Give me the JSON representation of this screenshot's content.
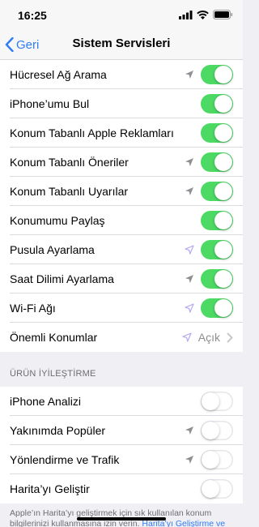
{
  "status": {
    "time": "16:25"
  },
  "nav": {
    "back_label": "Geri",
    "title": "Sistem Servisleri"
  },
  "services": [
    {
      "label": "Hücresel Ağ Arama",
      "arrow": "gray",
      "on": true
    },
    {
      "label": "iPhone’umu Bul",
      "arrow": "none",
      "on": true
    },
    {
      "label": "Konum Tabanlı Apple Reklamları",
      "arrow": "none",
      "on": true
    },
    {
      "label": "Konum Tabanlı Öneriler",
      "arrow": "gray",
      "on": true
    },
    {
      "label": "Konum Tabanlı Uyarılar",
      "arrow": "gray",
      "on": true
    },
    {
      "label": "Konumumu Paylaş",
      "arrow": "none",
      "on": true
    },
    {
      "label": "Pusula Ayarlama",
      "arrow": "purple-outline",
      "on": true
    },
    {
      "label": "Saat Dilimi Ayarlama",
      "arrow": "gray",
      "on": true
    },
    {
      "label": "Wi-Fi Ağı",
      "arrow": "purple-outline",
      "on": true
    }
  ],
  "important_locations": {
    "label": "Önemli Konumlar",
    "value": "Açık",
    "arrow": "purple-outline"
  },
  "section_header": "ÜRÜN İYİLEŞTİRME",
  "improvement": [
    {
      "label": "iPhone Analizi",
      "arrow": "none",
      "on": false
    },
    {
      "label": "Yakınımda Popüler",
      "arrow": "gray",
      "on": false
    },
    {
      "label": "Yönlendirme ve Trafik",
      "arrow": "gray",
      "on": false
    },
    {
      "label": "Harita’yı Geliştir",
      "arrow": "none",
      "on": false
    }
  ],
  "footer": {
    "text": "Apple’ın Harita’yı geliştirmek için sık kullanılan konum bilgilerinizi kullanmasına izin verin. ",
    "link": "Harita’yı Geliştirme ve"
  },
  "colors": {
    "accent": "#2f7cf6",
    "toggle_on": "#4cd964",
    "arrow_gray": "#8e8e93",
    "arrow_purple": "#b5a9f0"
  },
  "icons": [
    "back-chevron-icon",
    "location-arrow-icon",
    "chevron-right-icon",
    "signal-icon",
    "wifi-icon",
    "battery-icon"
  ]
}
